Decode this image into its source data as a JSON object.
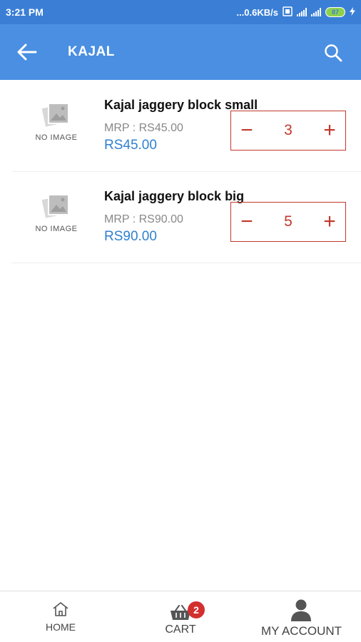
{
  "status_bar": {
    "time": "3:21 PM",
    "network_speed": "...0.6KB/s",
    "battery": "87"
  },
  "app_bar": {
    "title": "KAJAL",
    "back_icon": "arrow-left-icon",
    "search_icon": "search-icon"
  },
  "products": [
    {
      "image_text": "NO IMAGE",
      "name": "Kajal jaggery block small",
      "mrp": "MRP :  RS45.00",
      "price": "RS45.00",
      "quantity": "3"
    },
    {
      "image_text": "NO IMAGE",
      "name": "Kajal jaggery block big",
      "mrp": "MRP :  RS90.00",
      "price": "RS90.00",
      "quantity": "5"
    }
  ],
  "stepper": {
    "minus": "−",
    "plus": "+"
  },
  "bottom_nav": {
    "home_label": "HOME",
    "cart_label": "CART",
    "cart_badge": "2",
    "account_label": "MY ACCOUNT"
  },
  "colors": {
    "status_bar": "#3a7fd5",
    "app_bar": "#4a8fe2",
    "price": "#2f80d0",
    "stepper": "#c0392b",
    "badge": "#d32f2f"
  }
}
